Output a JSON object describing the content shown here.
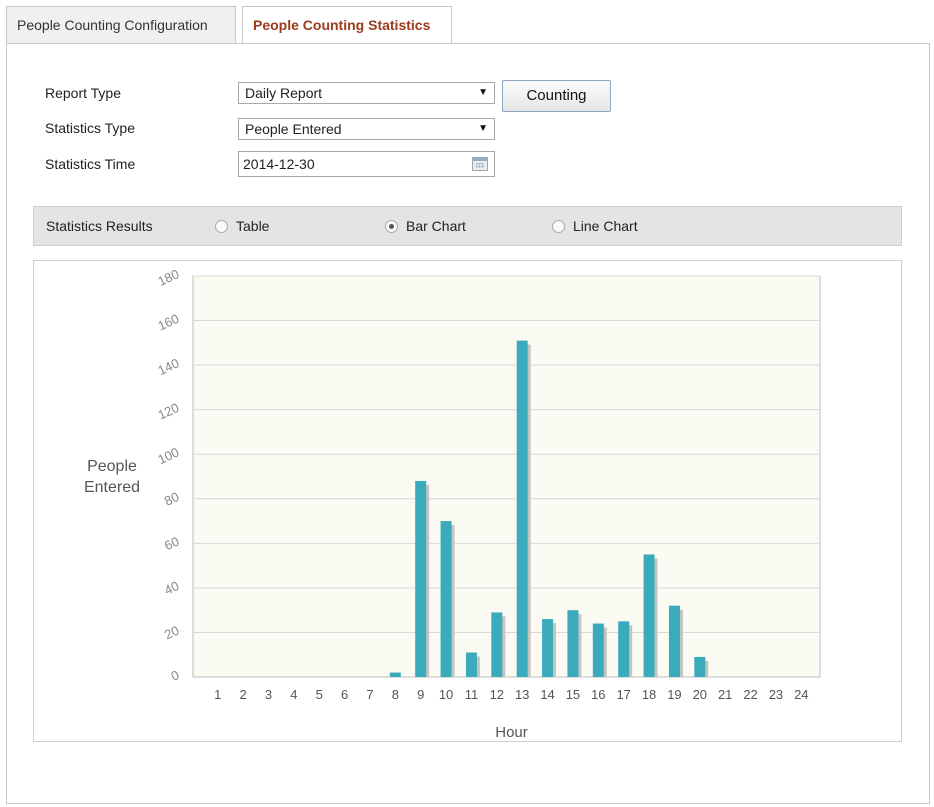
{
  "tabs": [
    {
      "label": "People Counting Configuration",
      "active": false
    },
    {
      "label": "People Counting Statistics",
      "active": true
    }
  ],
  "form": {
    "report_type_label": "Report Type",
    "report_type_value": "Daily Report",
    "statistics_type_label": "Statistics Type",
    "statistics_type_value": "People Entered",
    "statistics_time_label": "Statistics Time",
    "statistics_time_value": "2014-12-30",
    "counting_button": "Counting"
  },
  "results": {
    "label": "Statistics Results",
    "options": [
      {
        "label": "Table",
        "checked": false
      },
      {
        "label": "Bar Chart",
        "checked": true
      },
      {
        "label": "Line Chart",
        "checked": false
      }
    ]
  },
  "icons": {
    "dropdown": "triangle-down-icon",
    "calendar": "calendar-icon"
  },
  "colors": {
    "active_tab_text": "#9b3b1c",
    "bar": "#3aabbb",
    "bar_shadow": "#c4c4c4",
    "plot_background": "#fbfbf3"
  },
  "chart_data": {
    "type": "bar",
    "categories": [
      "1",
      "2",
      "3",
      "4",
      "5",
      "6",
      "7",
      "8",
      "9",
      "10",
      "11",
      "12",
      "13",
      "14",
      "15",
      "16",
      "17",
      "18",
      "19",
      "20",
      "21",
      "22",
      "23",
      "24"
    ],
    "values": [
      0,
      0,
      0,
      0,
      0,
      0,
      0,
      2,
      88,
      70,
      11,
      29,
      151,
      26,
      30,
      24,
      25,
      55,
      32,
      9,
      0,
      0,
      0,
      0
    ],
    "title": "",
    "xlabel": "Hour",
    "ylabel": "People Entered",
    "ylabel_lines": [
      "People",
      "Entered"
    ],
    "ylim": [
      0,
      180
    ],
    "yticks": [
      0,
      20,
      40,
      60,
      80,
      100,
      120,
      140,
      160,
      180
    ],
    "grid": true,
    "legend": "none"
  }
}
